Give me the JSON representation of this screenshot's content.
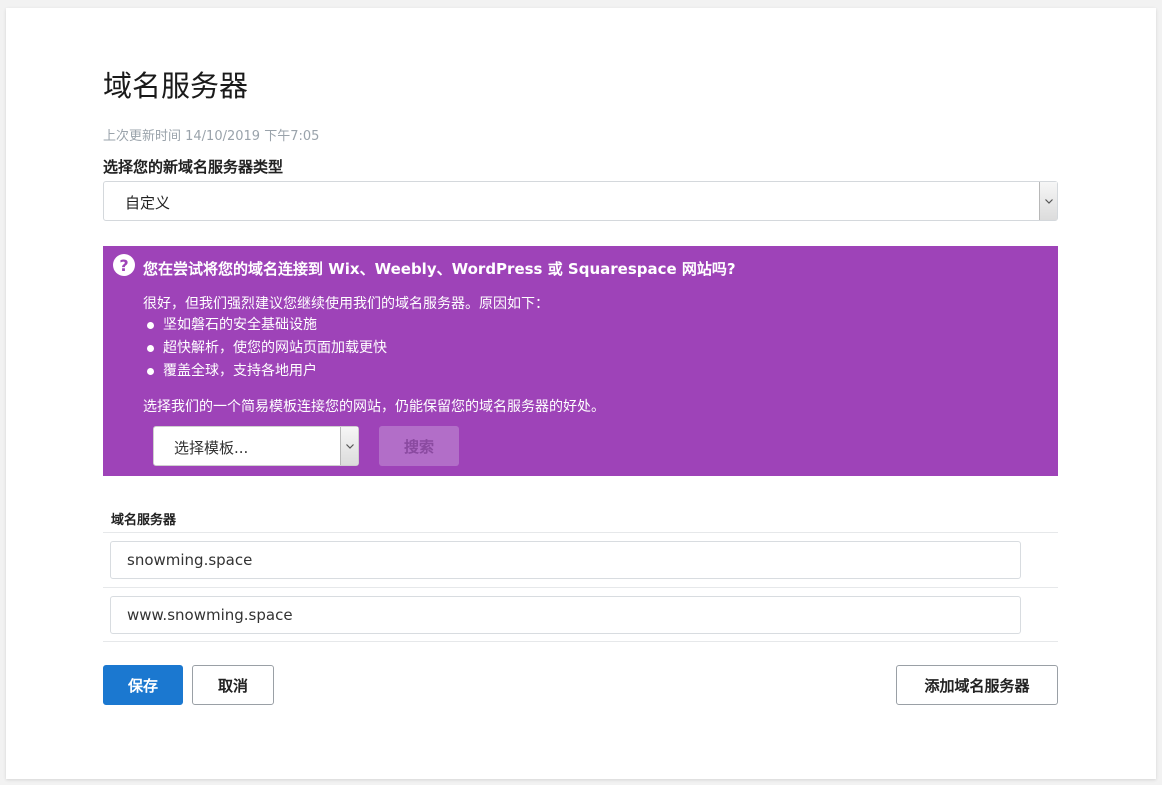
{
  "page": {
    "title": "域名服务器",
    "last_updated": "上次更新时间 14/10/2019 下午7:05"
  },
  "nameserver_type": {
    "label": "选择您的新域名服务器类型",
    "selected": "自定义"
  },
  "promo": {
    "icon": "question-icon",
    "title": "您在尝试将您的域名连接到 Wix、Weebly、WordPress 或 Squarespace 网站吗?",
    "intro": "很好，但我们强烈建议您继续使用我们的域名服务器。原因如下：",
    "reasons": [
      "坚如磐石的安全基础设施",
      "超快解析，使您的网站页面加载更快",
      "覆盖全球，支持各地用户"
    ],
    "footer": "选择我们的一个简易模板连接您的网站，仍能保留您的域名服务器的好处。",
    "template_select": "选择模板...",
    "search_label": "搜索",
    "background_color": "#9e43b8"
  },
  "nameservers": {
    "label": "域名服务器",
    "entries": [
      "snowming.space",
      "www.snowming.space"
    ]
  },
  "actions": {
    "save_label": "保存",
    "cancel_label": "取消",
    "add_label": "添加域名服务器",
    "primary_color": "#1b78d0"
  }
}
